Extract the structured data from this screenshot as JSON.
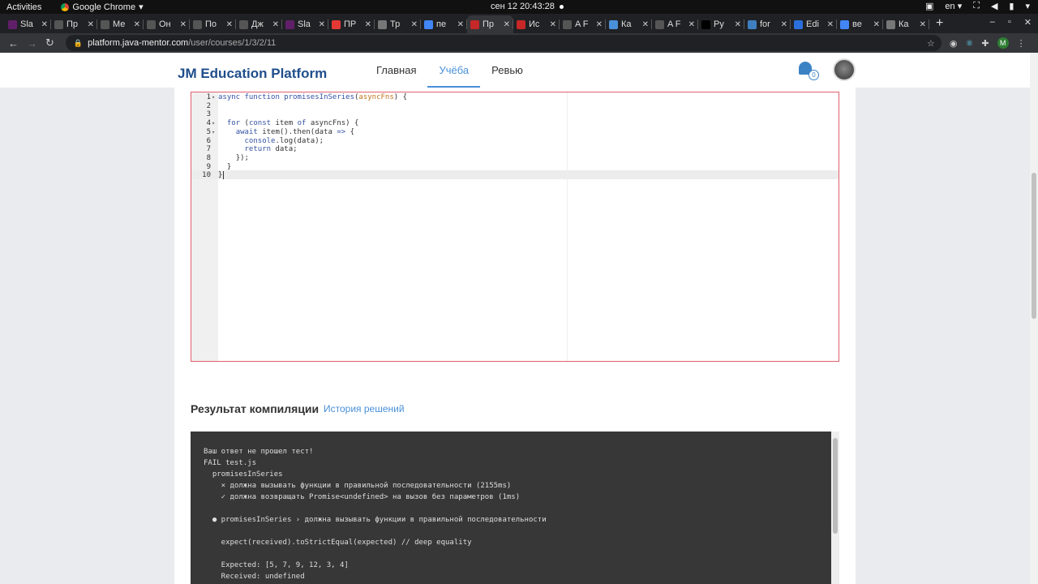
{
  "system_bar": {
    "activities": "Activities",
    "app_name": "Google Chrome",
    "app_menu_arrow": "▾",
    "clock": "сен 12  20:43:28",
    "lang": "en ▾"
  },
  "browser": {
    "tabs": [
      {
        "label": "Sla",
        "fav_color": "#611f69"
      },
      {
        "label": "Пр",
        "fav_color": "#555"
      },
      {
        "label": "Ме",
        "fav_color": "#555"
      },
      {
        "label": "Он",
        "fav_color": "#555"
      },
      {
        "label": "По",
        "fav_color": "#555"
      },
      {
        "label": "Дж",
        "fav_color": "#555"
      },
      {
        "label": "Sla",
        "fav_color": "#611f69"
      },
      {
        "label": "ПР",
        "fav_color": "#e53935"
      },
      {
        "label": "Тр",
        "fav_color": "#777"
      },
      {
        "label": "пе",
        "fav_color": "#4285f4"
      },
      {
        "label": "Пр",
        "fav_color": "#c62828",
        "active": true
      },
      {
        "label": "Ис",
        "fav_color": "#c62828"
      },
      {
        "label": "A F",
        "fav_color": "#555"
      },
      {
        "label": "Ка",
        "fav_color": "#4a90d9"
      },
      {
        "label": "A F",
        "fav_color": "#555"
      },
      {
        "label": "Ру",
        "fav_color": "#000"
      },
      {
        "label": "for",
        "fav_color": "#3f7fbf"
      },
      {
        "label": "Edi",
        "fav_color": "#2a6fdb"
      },
      {
        "label": "ве",
        "fav_color": "#4285f4"
      },
      {
        "label": "Ка",
        "fav_color": "#777"
      }
    ],
    "new_tab": "+",
    "url_host": "platform.java-mentor.com",
    "url_path": "/user/courses/1/3/2/11",
    "profile_initial": "M"
  },
  "header": {
    "brand": "JM Education Platform",
    "nav": [
      {
        "label": "Главная",
        "active": false
      },
      {
        "label": "Учёба",
        "active": true
      },
      {
        "label": "Ревью",
        "active": false
      }
    ],
    "notifications_count": "0"
  },
  "editor": {
    "lines": [
      {
        "n": "1",
        "fold": "▾"
      },
      {
        "n": "2",
        "fold": ""
      },
      {
        "n": "3",
        "fold": ""
      },
      {
        "n": "4",
        "fold": "▾"
      },
      {
        "n": "5",
        "fold": "▾"
      },
      {
        "n": "6",
        "fold": ""
      },
      {
        "n": "7",
        "fold": ""
      },
      {
        "n": "8",
        "fold": ""
      },
      {
        "n": "9",
        "fold": ""
      },
      {
        "n": "10",
        "fold": ""
      }
    ],
    "code": {
      "l1_kw1": "async",
      "l1_kw2": "function",
      "l1_name": "promisesInSeries",
      "l1_param": "asyncFns",
      "l1_rest": ") {",
      "l4_kw1": "for",
      "l4_kw2": "const",
      "l4_mid": " item ",
      "l4_kw3": "of",
      "l4_rest": " asyncFns) {",
      "l5_kw": "await",
      "l5_rest": " item().then(data ",
      "l5_arrow": "=>",
      "l5_end": " {",
      "l6_fn": "console",
      "l6_rest": ".log(data);",
      "l7_kw": "return",
      "l7_rest": " data;",
      "l8": "});",
      "l9": "}",
      "l10": "}"
    }
  },
  "result": {
    "title": "Результат компиляции",
    "history_link": "История решений",
    "console_lines": [
      "Ваш ответ не прошел тест!",
      "FAIL test.js",
      "  promisesInSeries",
      "    × должна вызывать функции в правильной последовательности (2155ms)",
      "    ✓ должна возвращать Promise<undefined> на вызов без параметров (1ms)",
      "",
      "  ● promisesInSeries › должна вызывать функции в правильной последовательности",
      "",
      "    expect(received).toStrictEqual(expected) // deep equality",
      "",
      "    Expected: [5, 7, 9, 12, 3, 4]",
      "    Received: undefined"
    ]
  },
  "colors": {
    "brand": "#1f4e8c",
    "accent": "#4a90d9",
    "editor_border": "#e0606f",
    "console_bg": "#373737"
  }
}
